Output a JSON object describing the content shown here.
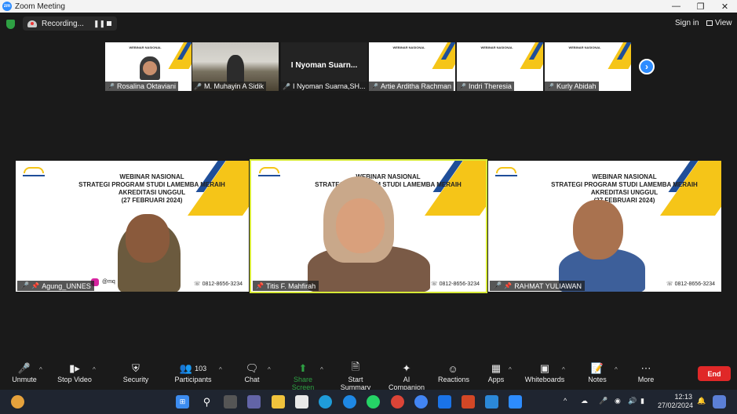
{
  "window": {
    "title": "Zoom Meeting",
    "logo": "zm"
  },
  "status": {
    "recording_label": "Recording...",
    "sign_in": "Sign in",
    "view": "View"
  },
  "thumbnails": [
    {
      "name": "Rosalina Oktaviani",
      "kind": "slide"
    },
    {
      "name": "M. Muhayin A Sidik",
      "kind": "photo"
    },
    {
      "name": "I Nyoman Suarna,SH...",
      "kind": "dark",
      "big": "I Nyoman Suarn..."
    },
    {
      "name": "Artie Arditha Rachman",
      "kind": "slide"
    },
    {
      "name": "Indri Theresia",
      "kind": "slide"
    },
    {
      "name": "Kurly Abidah",
      "kind": "slide"
    }
  ],
  "slide": {
    "line1": "WEBINAR NASIONAL",
    "line2": "STRATEGI PROGRAM STUDI LAMEMBA MERAIH",
    "line3": "AKREDITASI UNGGUL",
    "line4": "(27 FEBRUARI 2024)",
    "phone": "0812-8656-3234"
  },
  "tiles": [
    {
      "name": "Agung_UNNES",
      "active": false,
      "instagram": "@mq"
    },
    {
      "name": "Titis F. Mahfirah",
      "active": true
    },
    {
      "name": "RAHMAT YULIAWAN",
      "active": false
    }
  ],
  "toolbar": {
    "unmute": "Unmute",
    "stop_video": "Stop Video",
    "security": "Security",
    "participants": "Participants",
    "participants_count": "103",
    "chat": "Chat",
    "share_screen": "Share Screen",
    "start_summary": "Start Summary",
    "ai_companion": "AI Companion",
    "reactions": "Reactions",
    "apps": "Apps",
    "whiteboards": "Whiteboards",
    "notes": "Notes",
    "more": "More",
    "end": "End"
  },
  "taskbar": {
    "time": "12:13",
    "date": "27/02/2024"
  },
  "colors": {
    "accent": "#2d8cff",
    "active_speaker": "#d6e936",
    "end": "#e02828",
    "share": "#2ea043",
    "slide_yellow": "#f5c518",
    "slide_blue": "#1f4e99"
  }
}
